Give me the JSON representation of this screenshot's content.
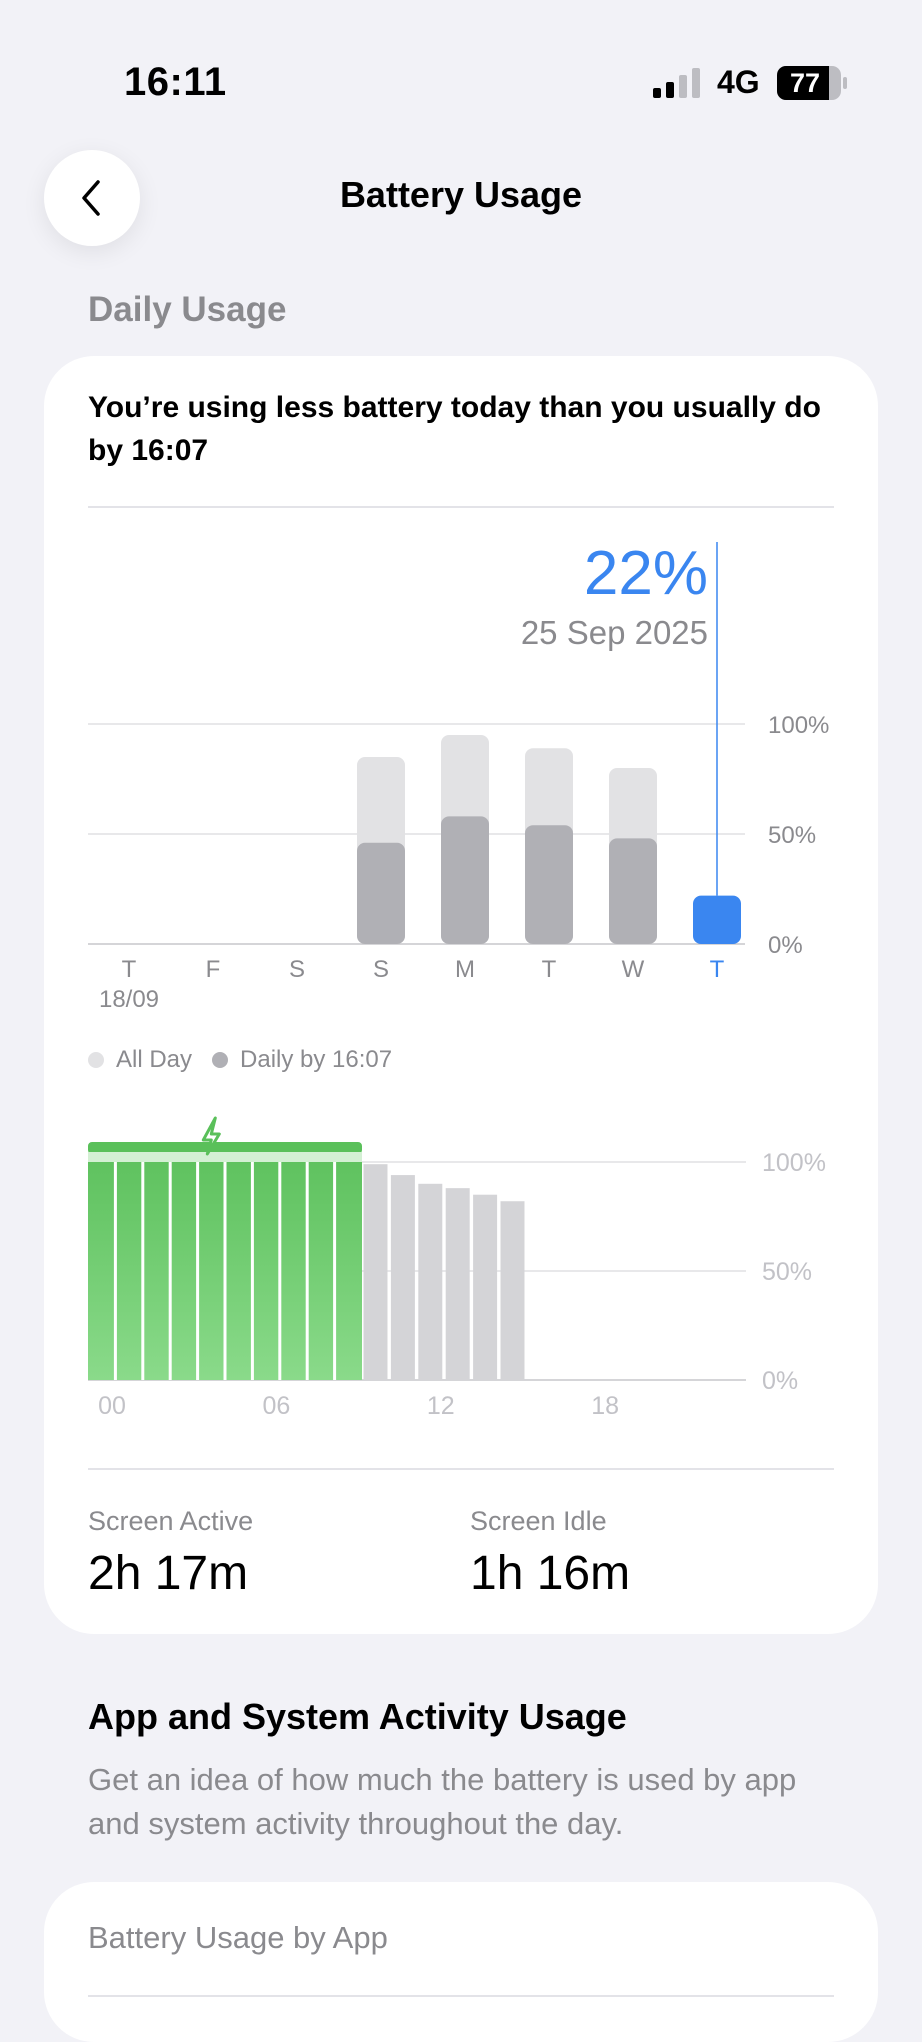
{
  "status_bar": {
    "time": "16:11",
    "network": "4G",
    "battery_level": "77",
    "signal_bars_active": 2,
    "signal_bars_total": 4
  },
  "nav": {
    "back_icon": "chevron-left-icon",
    "title": "Battery Usage"
  },
  "daily": {
    "section_label": "Daily Usage",
    "headline": "You’re using less battery today than you usually do by 16:07",
    "selected_percent": "22%",
    "selected_date": "25 Sep 2025",
    "colors": {
      "accent": "#3a86f0",
      "all_day": "#e2e2e4",
      "daily_by": "#b0b0b5"
    }
  },
  "chart_data": [
    {
      "type": "bar",
      "categories": [
        "T",
        "F",
        "S",
        "S",
        "M",
        "T",
        "W",
        "T"
      ],
      "first_category_sublabel": "18/09",
      "series": [
        {
          "name": "All Day",
          "values": [
            null,
            null,
            null,
            85,
            95,
            89,
            80,
            null
          ]
        },
        {
          "name": "Daily by 16:07",
          "values": [
            null,
            null,
            null,
            46,
            58,
            54,
            48,
            22
          ]
        }
      ],
      "highlighted_index": 7,
      "ylim": [
        0,
        100
      ],
      "y_ticks": [
        "100%",
        "50%",
        "0%"
      ],
      "legend": [
        "All Day",
        "Daily by 16:07"
      ],
      "legend_placement": "bottom-left",
      "grid": true
    },
    {
      "type": "bar",
      "x_ticks": [
        "00",
        "06",
        "12",
        "18"
      ],
      "hours": [
        0,
        1,
        2,
        3,
        4,
        5,
        6,
        7,
        8,
        9,
        10,
        11,
        12,
        13,
        14,
        15
      ],
      "values": [
        100,
        100,
        100,
        100,
        100,
        100,
        100,
        100,
        100,
        100,
        99,
        94,
        90,
        88,
        85,
        82
      ],
      "charging_hours": [
        0,
        1,
        2,
        3,
        4,
        5,
        6,
        7,
        8,
        9
      ],
      "charging_icon": "lightning-bolt-icon",
      "ylim": [
        0,
        100
      ],
      "y_ticks": [
        "100%",
        "50%",
        "0%"
      ],
      "colors": {
        "charging": "#6cc96c",
        "charging_band": "#5ac05a",
        "charging_band_light": "#d4f0d4",
        "discharge": "#d4d4d7"
      },
      "grid": true
    }
  ],
  "screen": {
    "active_label": "Screen Active",
    "active_value": "2h 17m",
    "idle_label": "Screen Idle",
    "idle_value": "1h 16m"
  },
  "activity": {
    "title": "App and System Activity Usage",
    "description": "Get an idea of how much the battery is used by app and system activity throughout the day."
  },
  "by_app": {
    "title": "Battery Usage by App"
  }
}
